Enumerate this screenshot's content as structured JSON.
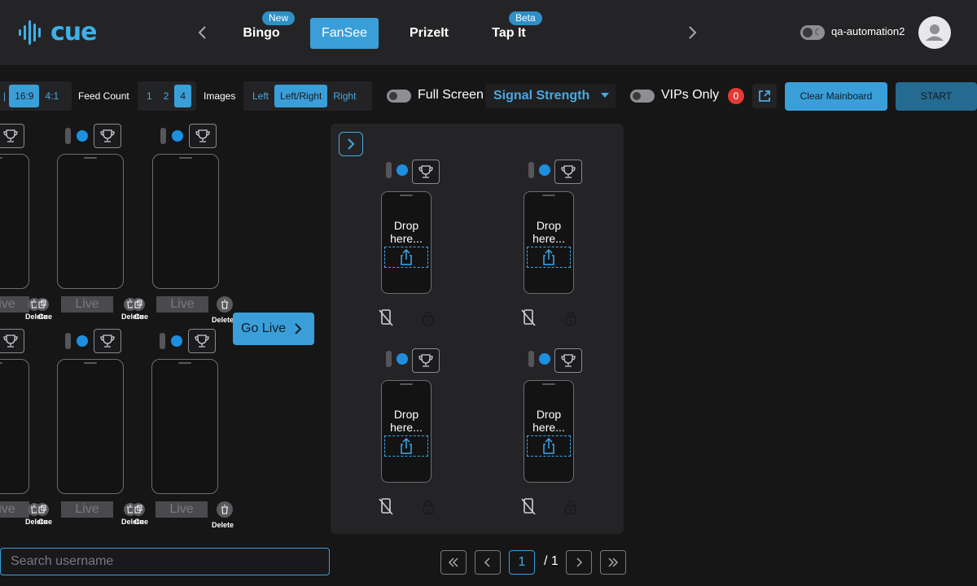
{
  "header": {
    "logo_text": "cue",
    "tabs": [
      {
        "label": "Bingo",
        "badge": "New",
        "active": false
      },
      {
        "label": "FanSee",
        "badge": "",
        "active": true
      },
      {
        "label": "PrizeIt",
        "badge": "",
        "active": false
      },
      {
        "label": "Tap It",
        "badge": "Beta",
        "active": false
      }
    ],
    "username": "qa-automation2"
  },
  "toolbar": {
    "aspect_options": [
      "16:9",
      "4:1"
    ],
    "aspect_selected": "16:9",
    "feed_count_label": "Feed Count",
    "feed_count_options": [
      "1",
      "2",
      "4"
    ],
    "feed_count_selected": "4",
    "images_label": "Images",
    "images_options": [
      "Left",
      "Left/Right",
      "Right"
    ],
    "images_selected": "Left/Right",
    "full_screen_label": "Full Screen",
    "full_screen_on": false,
    "sort_select_value": "Signal Strength",
    "vips_only_label": "VIPs Only",
    "vips_only_on": false,
    "vip_count": "0",
    "clear_label": "Clear Mainboard",
    "start_label": "START"
  },
  "feeds": {
    "live_label": "Live",
    "delete_label": "Delete",
    "cue_label": "Cue",
    "go_live_label": "Go Live"
  },
  "mainboard": {
    "drop_label": "Drop here..."
  },
  "search": {
    "placeholder": "Search username"
  },
  "pagination": {
    "current": "1",
    "total": "/ 1"
  },
  "colors": {
    "accent": "#3a9fd9",
    "background": "#161617",
    "panel": "#242426",
    "status_dot": "#1d8fe0",
    "vip_badge": "#e53935"
  },
  "icons": [
    "logo-wave-icon",
    "chevron-left-icon",
    "chevron-right-icon",
    "moon-icon",
    "user-icon",
    "external-link-icon",
    "trophy-icon",
    "trash-icon",
    "cue-icon",
    "share-upload-icon",
    "phone-off-icon",
    "lock-icon",
    "first-page-icon",
    "last-page-icon"
  ]
}
